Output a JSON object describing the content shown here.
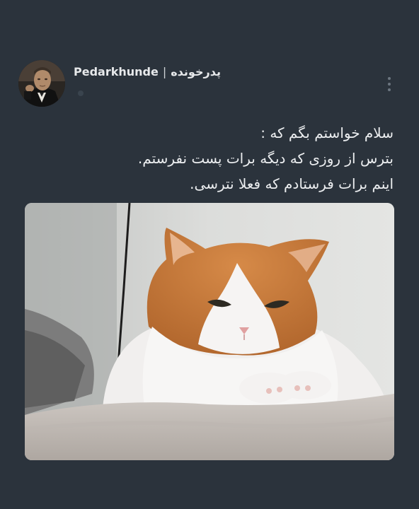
{
  "post": {
    "display_name": "Pedarkhunde",
    "separator": "|",
    "persian_name": "پدرخونده",
    "text_lines": [
      "سلام خواستم بگم که :",
      "بترس از روزی که دیگه برات پست نفرستم.",
      "اینم برات فرستادم که فعلا نترسی."
    ]
  },
  "icons": {
    "more": "more-vertical-icon",
    "avatar": "profile-avatar"
  },
  "colors": {
    "background": "#2b333c",
    "text": "#eceef0",
    "cat_orange": "#c7793a"
  }
}
